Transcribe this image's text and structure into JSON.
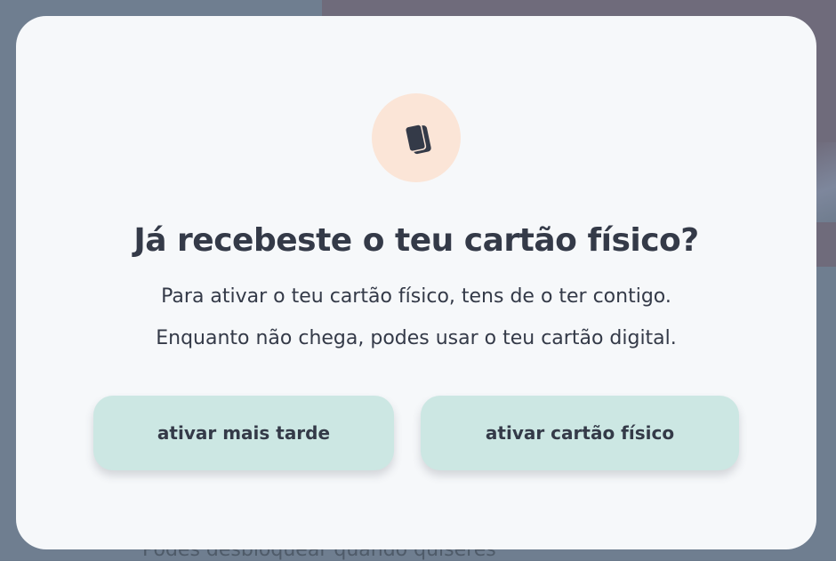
{
  "background": {
    "partial_text": "Podes desbloquear quando quiseres"
  },
  "modal": {
    "icon": "cards-icon",
    "title": "Já recebeste o teu cartão físico?",
    "text_line1": "Para ativar o teu cartão físico, tens de o ter contigo.",
    "text_line2": "Enquanto não chega, podes usar o teu cartão digital.",
    "buttons": {
      "later": "ativar mais tarde",
      "activate": "ativar cartão físico"
    }
  },
  "colors": {
    "modal_bg": "#f6f8fa",
    "icon_bg": "#fbe5d7",
    "button_bg": "#cce7e3",
    "text": "#343a48",
    "overlay": "#6f7e90"
  }
}
